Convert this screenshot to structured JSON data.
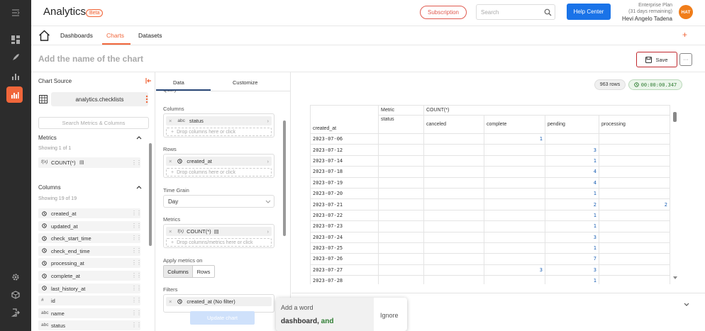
{
  "app": {
    "title": "Analytics",
    "badge": "Beta"
  },
  "rail": {
    "icons": [
      "collapse-icon",
      "dashboard-icon",
      "rocket-icon",
      "hierarchy-icon",
      "bar-chart-icon",
      "gear-icon",
      "cube-icon",
      "logout-icon"
    ]
  },
  "header": {
    "subscription_label": "Subscription",
    "search_placeholder": "Search",
    "help_label": "Help Center",
    "plan": "Enterprise Plan",
    "days_remaining": "(31 days remaining)",
    "user_name": "Hevi Angelo Tadena",
    "avatar_initials": "HAT"
  },
  "nav": {
    "tabs": [
      "Dashboards",
      "Charts",
      "Datasets"
    ],
    "active": "Charts",
    "add_label": "+"
  },
  "chart_title": {
    "placeholder": "Add the name of the chart"
  },
  "toolbar": {
    "save_label": "Save",
    "more_label": "···"
  },
  "source": {
    "title": "Chart Source",
    "dataset": "analytics.checklists",
    "search_placeholder": "Search Metrics & Columns",
    "metrics_title": "Metrics",
    "metrics_count": "Showing 1 of 1",
    "metrics": [
      {
        "fn": "f(x)",
        "label": "COUNT(*)"
      }
    ],
    "columns_title": "Columns",
    "columns_count": "Showing 19 of 19",
    "columns": [
      {
        "type": "clock",
        "label": "created_at"
      },
      {
        "type": "clock",
        "label": "updated_at"
      },
      {
        "type": "clock",
        "label": "check_start_time"
      },
      {
        "type": "clock",
        "label": "check_end_time"
      },
      {
        "type": "clock",
        "label": "processing_at"
      },
      {
        "type": "clock",
        "label": "complete_at"
      },
      {
        "type": "clock",
        "label": "last_history_at"
      },
      {
        "type": "#",
        "label": "id"
      },
      {
        "type": "abc",
        "label": "name"
      },
      {
        "type": "abc",
        "label": "status"
      }
    ]
  },
  "config": {
    "tabs": [
      "Data",
      "Customize"
    ],
    "query_label": "Query",
    "columns_label": "Columns",
    "columns_pill": {
      "type": "abc",
      "label": "status"
    },
    "columns_drop": "Drop columns here or click",
    "rows_label": "Rows",
    "rows_pill": "created_at",
    "rows_drop": "Drop columns here or click",
    "time_grain_label": "Time Grain",
    "time_grain_value": "Day",
    "metrics_label": "Metrics",
    "metrics_pill": {
      "fn": "f(x)",
      "label": "COUNT(*)"
    },
    "metrics_drop": "Drop columns/metrics here or click",
    "apply_label": "Apply metrics on",
    "apply_options": [
      "Columns",
      "Rows"
    ],
    "filters_label": "Filters",
    "filters_pill": "created_at (No filter)",
    "update_label": "Update chart"
  },
  "results": {
    "rows_badge": "963 rows",
    "time_badge": "00:00:00.347",
    "header": {
      "metric": "Metric",
      "count": "COUNT(*)",
      "status": "status",
      "rowlabel": "created_at"
    },
    "statuses": [
      "canceled",
      "complete",
      "pending",
      "processing"
    ],
    "rows": [
      {
        "date": "2023-07-06",
        "v": [
          "",
          "1",
          "",
          ""
        ]
      },
      {
        "date": "2023-07-12",
        "v": [
          "",
          "",
          "3",
          ""
        ]
      },
      {
        "date": "2023-07-14",
        "v": [
          "",
          "",
          "1",
          ""
        ]
      },
      {
        "date": "2023-07-18",
        "v": [
          "",
          "",
          "4",
          ""
        ]
      },
      {
        "date": "2023-07-19",
        "v": [
          "",
          "",
          "4",
          ""
        ]
      },
      {
        "date": "2023-07-20",
        "v": [
          "",
          "",
          "1",
          ""
        ]
      },
      {
        "date": "2023-07-21",
        "v": [
          "",
          "",
          "2",
          "2"
        ]
      },
      {
        "date": "2023-07-22",
        "v": [
          "",
          "",
          "1",
          ""
        ]
      },
      {
        "date": "2023-07-23",
        "v": [
          "",
          "",
          "1",
          ""
        ]
      },
      {
        "date": "2023-07-24",
        "v": [
          "",
          "",
          "3",
          ""
        ]
      },
      {
        "date": "2023-07-25",
        "v": [
          "",
          "",
          "1",
          ""
        ]
      },
      {
        "date": "2023-07-26",
        "v": [
          "",
          "",
          "7",
          ""
        ]
      },
      {
        "date": "2023-07-27",
        "v": [
          "",
          "3",
          "3",
          ""
        ]
      },
      {
        "date": "2023-07-28",
        "v": [
          "",
          "",
          "1",
          ""
        ]
      }
    ]
  },
  "spell_popup": {
    "title": "Add a word",
    "text_dark": "dashboard,",
    "text_green": " and",
    "ignore_label": "Ignore"
  }
}
